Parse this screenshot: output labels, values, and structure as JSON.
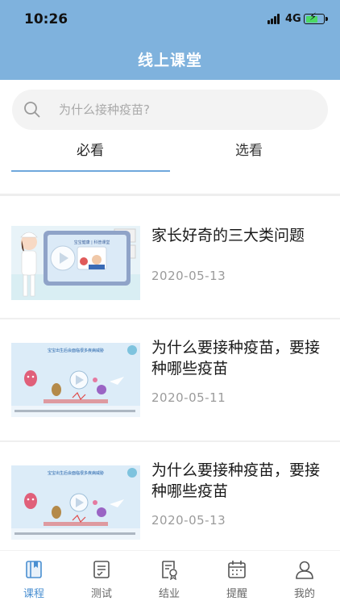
{
  "status_bar": {
    "time": "10:26",
    "network": "4G"
  },
  "header": {
    "title": "线上课堂"
  },
  "search": {
    "placeholder": "为什么接种疫苗?"
  },
  "tabs": [
    {
      "label": "必看",
      "active": true
    },
    {
      "label": "选看",
      "active": false
    }
  ],
  "courses": [
    {
      "title": "家长好奇的三大类问题",
      "date": "2020-05-13",
      "thumb_caption": "宝宝健康 | 科普课堂"
    },
    {
      "title": "为什么要接种疫苗，要接种哪些疫苗",
      "date": "2020-05-11",
      "thumb_caption": "宝宝出生后会面临很多疾病威胁"
    },
    {
      "title": "为什么要接种疫苗，要接种哪些疫苗",
      "date": "2020-05-13",
      "thumb_caption": "宝宝出生后会面临很多疾病威胁"
    }
  ],
  "tabbar": [
    {
      "label": "课程",
      "icon": "book-icon",
      "active": true
    },
    {
      "label": "测试",
      "icon": "test-clipboard-icon",
      "active": false
    },
    {
      "label": "结业",
      "icon": "certificate-icon",
      "active": false
    },
    {
      "label": "提醒",
      "icon": "calendar-icon",
      "active": false
    },
    {
      "label": "我的",
      "icon": "user-icon",
      "active": false
    }
  ],
  "colors": {
    "header": "#7fb2dd",
    "accent": "#4a8fd1",
    "tab_underline": "#6fa8dc",
    "date": "#9b9b9b"
  }
}
